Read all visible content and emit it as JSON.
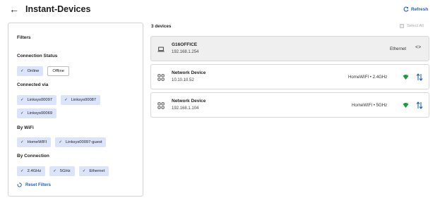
{
  "header": {
    "back_icon": "arrow-left-icon",
    "title": "Instant-Devices",
    "refresh_label": "Refresh",
    "refresh_icon": "refresh-icon"
  },
  "filters": {
    "title": "Filters",
    "connection_status": {
      "label": "Connection Status",
      "options": [
        "Online",
        "Offline"
      ]
    },
    "connected_via": {
      "label": "Connected via",
      "options": [
        "Linksys00097",
        "Linksys00087",
        "Linksys00069"
      ]
    },
    "by_wifi": {
      "label": "By WiFi",
      "options": [
        "HomeWIFI",
        "Linksys00097-guest"
      ]
    },
    "by_connection": {
      "label": "By Connection",
      "options": [
        "2.4GHz",
        "5GHz",
        "Ethernet"
      ]
    },
    "reset_label": "Reset Filters"
  },
  "devices": {
    "count_label": "3 devices",
    "select_all_label": "Select All",
    "items": [
      {
        "name": "G16OFFICE",
        "ip": "192.168.1.254",
        "connection": "Ethernet",
        "icon": "laptop-icon"
      },
      {
        "name": "Network Device",
        "ip": "10.10.10.52",
        "connection": "HomeWIFI • 2.4GHz",
        "icon": "apps-grid-icon"
      },
      {
        "name": "Network Device",
        "ip": "192.168.1.104",
        "connection": "HomeWIFI • 5GHz",
        "icon": "apps-grid-icon"
      }
    ]
  },
  "colors": {
    "accent": "#1f5fd1",
    "chip_bg": "#dbe4fa",
    "wifi_green": "#1a9b3c",
    "selected_card_bg": "#efefef"
  }
}
